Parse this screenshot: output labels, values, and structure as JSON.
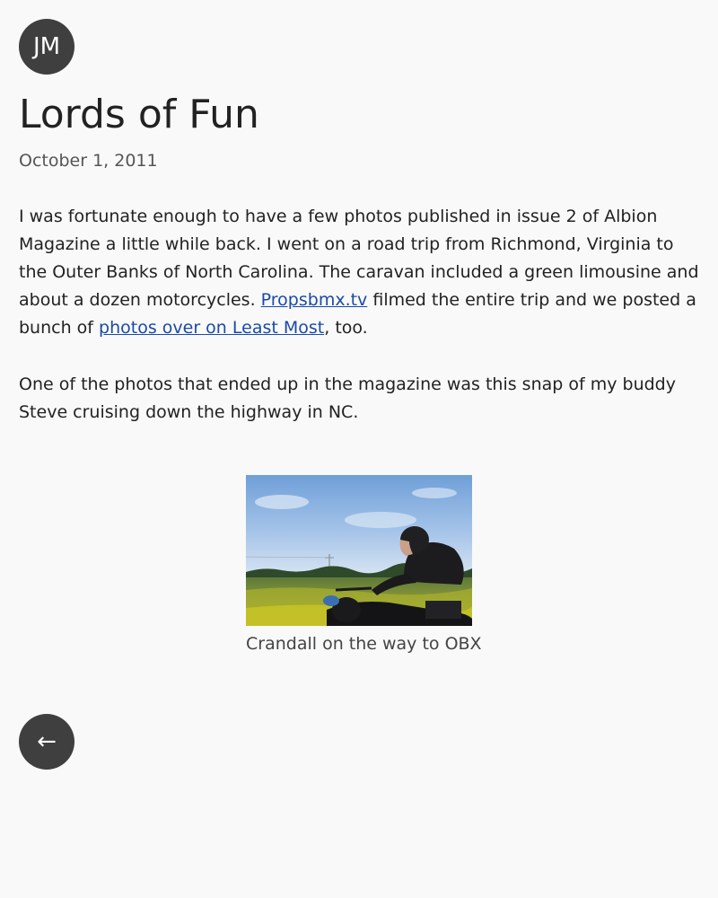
{
  "header": {
    "avatar_initials": "JM"
  },
  "post": {
    "title": "Lords of Fun",
    "date": "October 1, 2011",
    "paragraph1": {
      "text_before_link1": "I was fortunate enough to have a few photos published in issue 2 of Albion Magazine a little while back. I went on a road trip from Richmond, Virginia to the Outer Banks of North Carolina. The caravan included a green limousine and about a dozen motorcycles. ",
      "link1_label": "Propsbmx.tv",
      "text_between_links": " filmed the entire trip and we posted a bunch of ",
      "link2_label": "photos over on Least Most",
      "text_after_link2": ", too."
    },
    "paragraph2": "One of the photos that ended up in the magazine was this snap of my buddy Steve cruising down the highway in NC.",
    "figure": {
      "caption": "Crandall on the way to OBX"
    }
  },
  "footer": {
    "back_label": "←"
  },
  "colors": {
    "background": "#f9f9f9",
    "avatar_bg": "#3f3f3f",
    "link": "#1a4aa8",
    "text": "#222222"
  },
  "icons": {
    "back": "left-arrow-icon"
  }
}
